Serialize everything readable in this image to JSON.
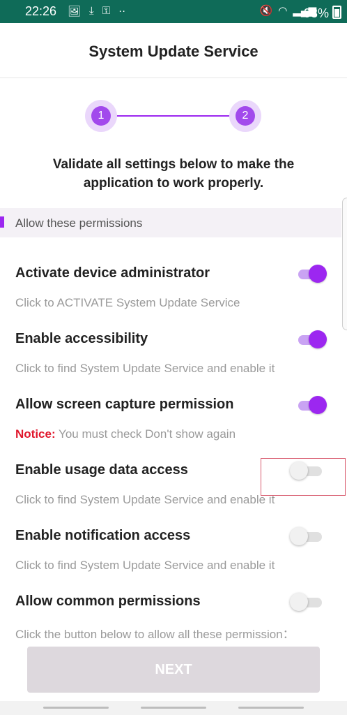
{
  "status_bar": {
    "time": "22:26",
    "battery": "93%",
    "left_icons": [
      "image-icon",
      "download-icon",
      "key-icon",
      "more-icon"
    ],
    "right_icons": [
      "mute-icon",
      "wifi-icon",
      "signal-icon",
      "battery-icon"
    ]
  },
  "header": {
    "title": "System Update Service"
  },
  "stepper": {
    "steps": [
      "1",
      "2"
    ]
  },
  "instruction": "Validate all settings below to make the application to work properly.",
  "section": {
    "label": "Allow these permissions"
  },
  "permissions": [
    {
      "title": "Activate device administrator",
      "description": "Click to ACTIVATE System Update Service",
      "enabled": true
    },
    {
      "title": "Enable accessibility",
      "description": "Click to find System Update Service and enable it",
      "enabled": true
    },
    {
      "title": "Allow screen capture permission",
      "notice_label": "Notice:",
      "description": " You must check Don't show again",
      "enabled": true
    },
    {
      "title": "Enable usage data access",
      "description": "Click to find System Update Service and enable it",
      "enabled": false
    },
    {
      "title": "Enable notification access",
      "description": "Click to find System Update Service and enable it",
      "enabled": false
    },
    {
      "title": "Allow common permissions",
      "description": "Click the button below to allow all these permission：",
      "enabled": false
    }
  ],
  "next_button": {
    "label": "NEXT"
  },
  "colors": {
    "accent": "#9c27f0",
    "status_bar": "#0f6b58",
    "notice": "#e0162b"
  }
}
